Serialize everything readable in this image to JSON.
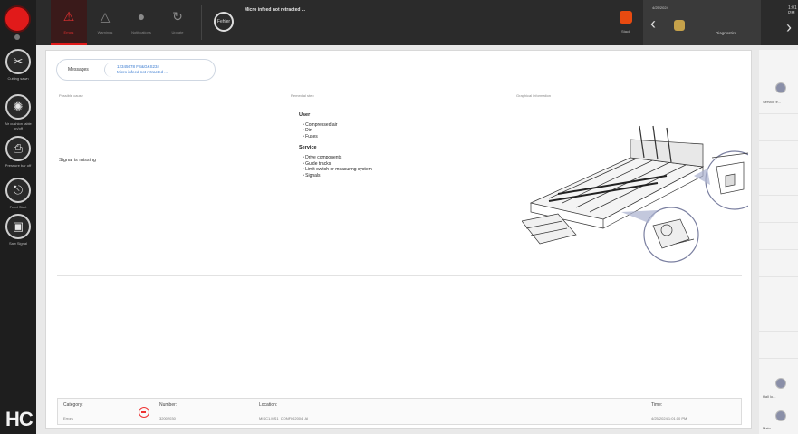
{
  "sidebar": {
    "items": [
      {
        "label": "Cutting sawn",
        "icon": "saw-icon"
      },
      {
        "label": "Air cushion table on/off",
        "icon": "fan-icon"
      },
      {
        "label": "Pressure bar off",
        "icon": "printer-icon"
      },
      {
        "label": "Feed Start",
        "icon": "feed-icon"
      },
      {
        "label": "Saw Signal",
        "icon": "signal-icon"
      }
    ],
    "logo": "HC"
  },
  "topbar": {
    "tabs": [
      {
        "label": "Errors",
        "icon": "error-icon"
      },
      {
        "label": "Warnings",
        "icon": "warning-icon"
      },
      {
        "label": "Notifications",
        "icon": "info-icon"
      },
      {
        "label": "Update",
        "icon": "update-icon"
      }
    ],
    "status_badge": "Fehler",
    "message": "Micro infeed not retracted ...",
    "lamp_label": "Stack",
    "date": "4/25/2024",
    "nav_label": "Diagnostics",
    "time": "1:01 PM"
  },
  "main": {
    "pill": {
      "label": "Messages",
      "line1": "12345678 FS&G&S234",
      "line2": "Micro infeed not retracted ..."
    },
    "columns": [
      "Possible cause",
      "Remedial step",
      "Graphical information"
    ],
    "cause": "Signal is missing",
    "remedy": {
      "user_title": "User",
      "user_items": [
        "Compressed air",
        "Dirt",
        "Fuses"
      ],
      "service_title": "Service",
      "service_items": [
        "Drive components",
        "Guide tracks",
        "Limit switch or measuring system",
        "Signals"
      ]
    },
    "footer": {
      "category_label": "Category:",
      "category_value": "Errors",
      "number_label": "Number:",
      "number_value": "32002030",
      "location_label": "Location:",
      "location_value": "MISC1.MS1_CONFIG2004_AI",
      "time_label": "Time:",
      "time_value": "4/25/2024 1:01:10 PM"
    }
  },
  "rpane": {
    "items": [
      "Service fr...",
      "Hall lo...",
      "Main"
    ]
  }
}
